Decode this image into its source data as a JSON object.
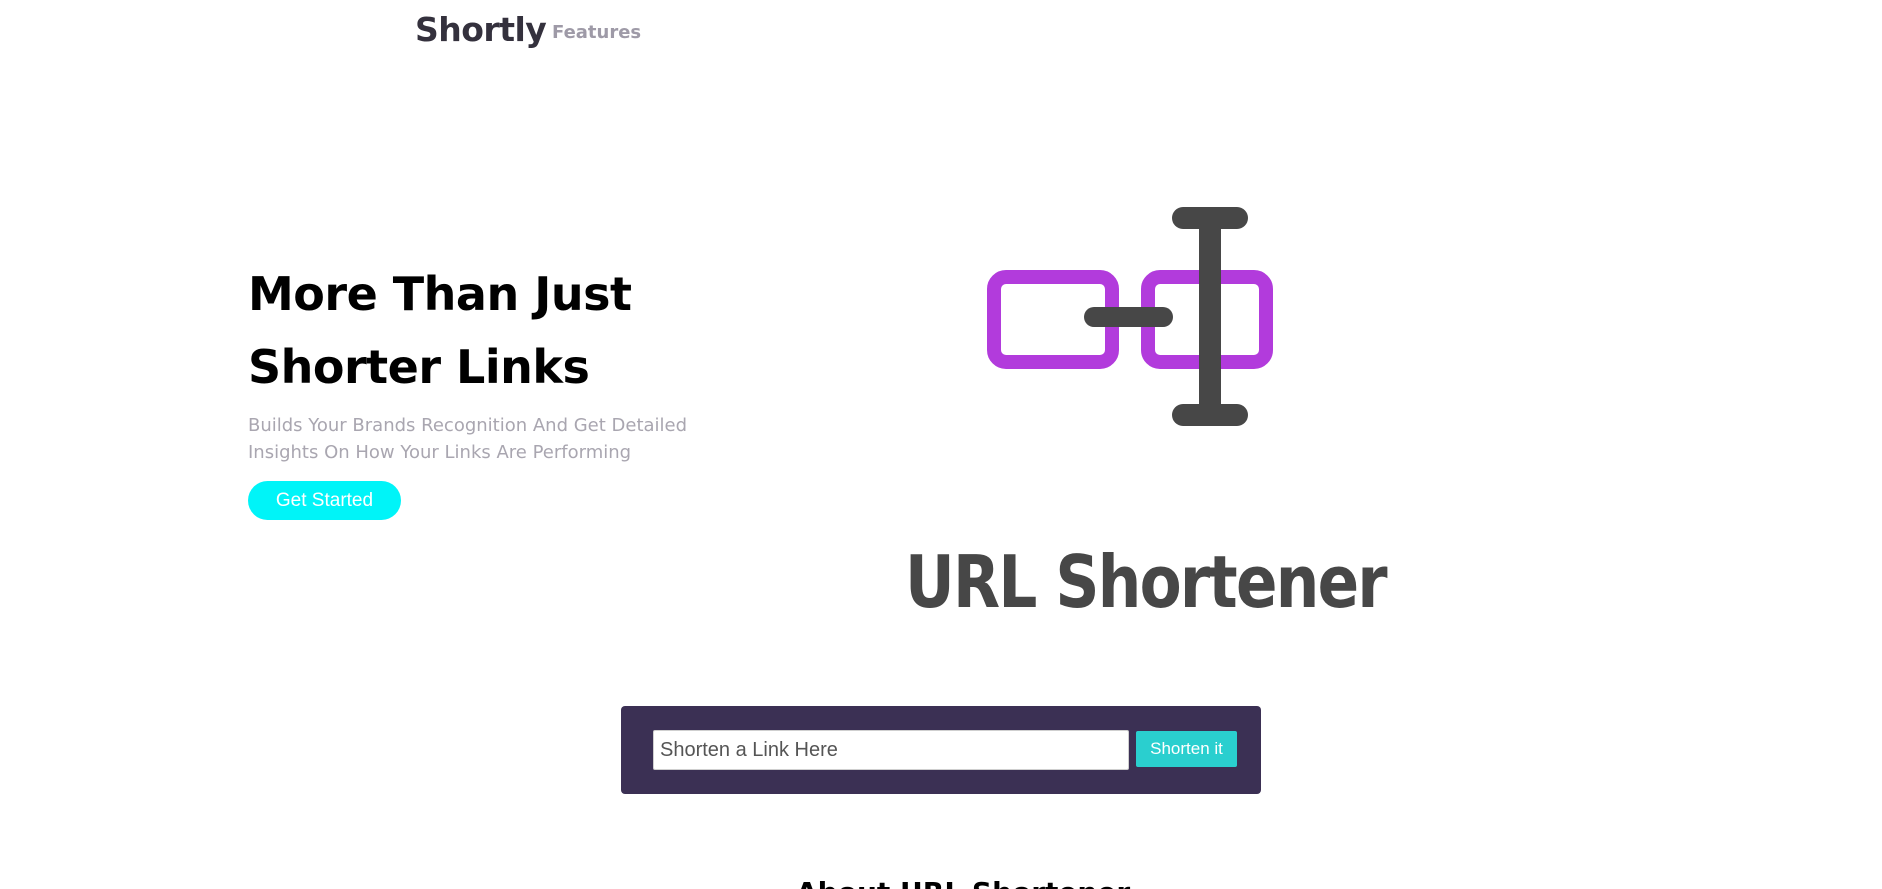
{
  "nav": {
    "brand": "Shortly",
    "features": "Features"
  },
  "hero": {
    "title_line1": "More Than Just",
    "title_line2": "Shorter Links",
    "subtitle_line1": "Builds Your Brands Recognition And Get Detailed",
    "subtitle_line2": "Insights On How Your Links Are Performing",
    "cta_label": "Get Started"
  },
  "illustration": {
    "icon": "chain-link-cursor-icon",
    "text": "URL Shortener",
    "colors": {
      "link": "#b23bdc",
      "cursor": "#474747"
    }
  },
  "shorten": {
    "placeholder": "Shorten a Link Here",
    "value": "",
    "button_label": "Shorten it"
  },
  "about": {
    "heading": "About URL Shortener"
  },
  "colors": {
    "accent_cyan": "#00f4f8",
    "button_teal": "#2acfcf",
    "shorten_bg": "#3b3054",
    "brand_text": "#34313d"
  }
}
